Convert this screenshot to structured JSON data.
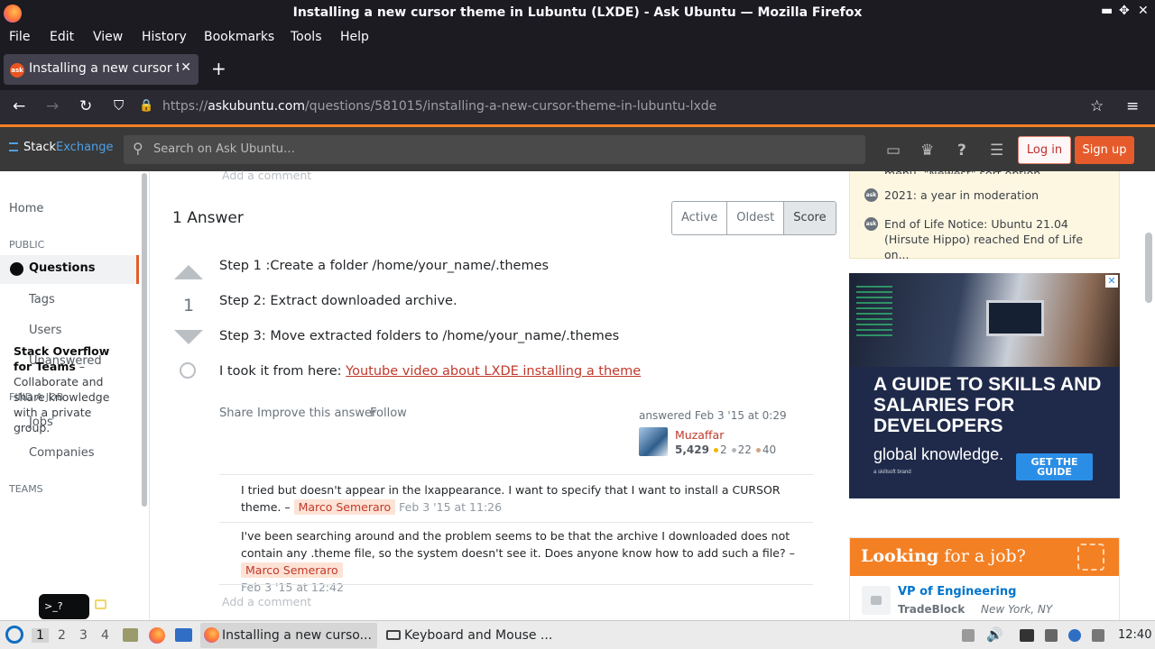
{
  "window": {
    "title": "Installing a new cursor theme in Lubuntu (LXDE) - Ask Ubuntu — Mozilla Firefox",
    "min": "▬",
    "max": "✥",
    "close": "✕"
  },
  "menubar": [
    "File",
    "Edit",
    "View",
    "History",
    "Bookmarks",
    "Tools",
    "Help"
  ],
  "tab": {
    "favicon": "ask",
    "label": "Installing a new cursor theme",
    "close": "✕",
    "new": "+"
  },
  "nav": {
    "back": "←",
    "forward": "→",
    "reload": "↻",
    "shield": "⛉",
    "lock": "🔒",
    "url_prefix": "https://",
    "url_host": "askubuntu.com",
    "url_path": "/questions/581015/installing-a-new-cursor-theme-in-lubuntu-lxde",
    "star": "☆",
    "menu": "≡"
  },
  "se": {
    "logo_stack": "Stack",
    "logo_exchange": "Exchange",
    "search_placeholder": "Search on Ask Ubuntu…",
    "search_icon": "⚲",
    "icons": {
      "inbox": "▭",
      "trophy": "♛",
      "help": "?",
      "switcher": "☰"
    },
    "login": "Log in",
    "signup": "Sign up"
  },
  "leftnav": {
    "home": "Home",
    "public_hdr": "PUBLIC",
    "questions": "Questions",
    "tags": "Tags",
    "users": "Users",
    "unanswered": "Unanswered",
    "job_hdr": "FIND A JOB",
    "jobs": "Jobs",
    "companies": "Companies",
    "teams_hdr": "TEAMS",
    "teams_title": "Stack Overflow for Teams",
    "teams_body": " – Collaborate and share knowledge with a private group.",
    "term": ">_?"
  },
  "main": {
    "add_comment_top": "Add a comment",
    "answers_title": "1 Answer",
    "sort": [
      "Active",
      "Oldest",
      "Score"
    ],
    "score": "1",
    "steps": [
      "Step 1 :Create a folder /home/your_name/.themes",
      "Step 2: Extract downloaded archive.",
      "Step 3: Move extracted folders to /home/your_name/.themes"
    ],
    "source_prefix": "I took it from here: ",
    "source_link": "Youtube video about LXDE installing a theme",
    "actions": [
      "Share",
      "Improve this answer",
      "Follow"
    ],
    "answered": "answered Feb 3 '15 at 0:29",
    "user": {
      "name": "Muzaffar",
      "rep": "5,429",
      "gold": "2",
      "silver": "22",
      "bronze": "40"
    },
    "comments": [
      {
        "text": "I tried but doesn't appear in the lxappearance. I want to specify that I want to install a CURSOR theme. –",
        "user": "Marco Semeraro",
        "date": "Feb 3 '15 at 11:26"
      },
      {
        "text": "I've been searching around and the problem seems to be that the archive I downloaded does not contain any .theme file, so the system doesn't see it. Does anyone know how to add such a file? –",
        "user": "Marco Semeraro",
        "date": "Feb 3 '15 at 12:42"
      }
    ],
    "add_comment_bottom": "Add a comment"
  },
  "sidebar": {
    "partial": "menu, \"Newest\" sort option, renaming...",
    "items": [
      "2021: a year in moderation",
      "End of Life Notice: Ubuntu 21.04 (Hirsute Hippo) reached End of Life on..."
    ],
    "ad": {
      "headline": "A GUIDE TO SKILLS AND SALARIES FOR DEVELOPERS",
      "brand": "global knowledge.",
      "brand_sub": "a skillsoft brand",
      "cta": "GET THE GUIDE",
      "close": "✕"
    },
    "jobs": {
      "hdr_bold": "Looking",
      "hdr_rest": " for a job?",
      "title": "VP of Engineering",
      "company": "TradeBlock",
      "location": "New York, NY"
    }
  },
  "taskbar": {
    "workspaces": [
      "1",
      "2",
      "3",
      "4"
    ],
    "windows": [
      "Installing a new curso...",
      "Keyboard and Mouse ..."
    ],
    "clock": "12:40"
  }
}
